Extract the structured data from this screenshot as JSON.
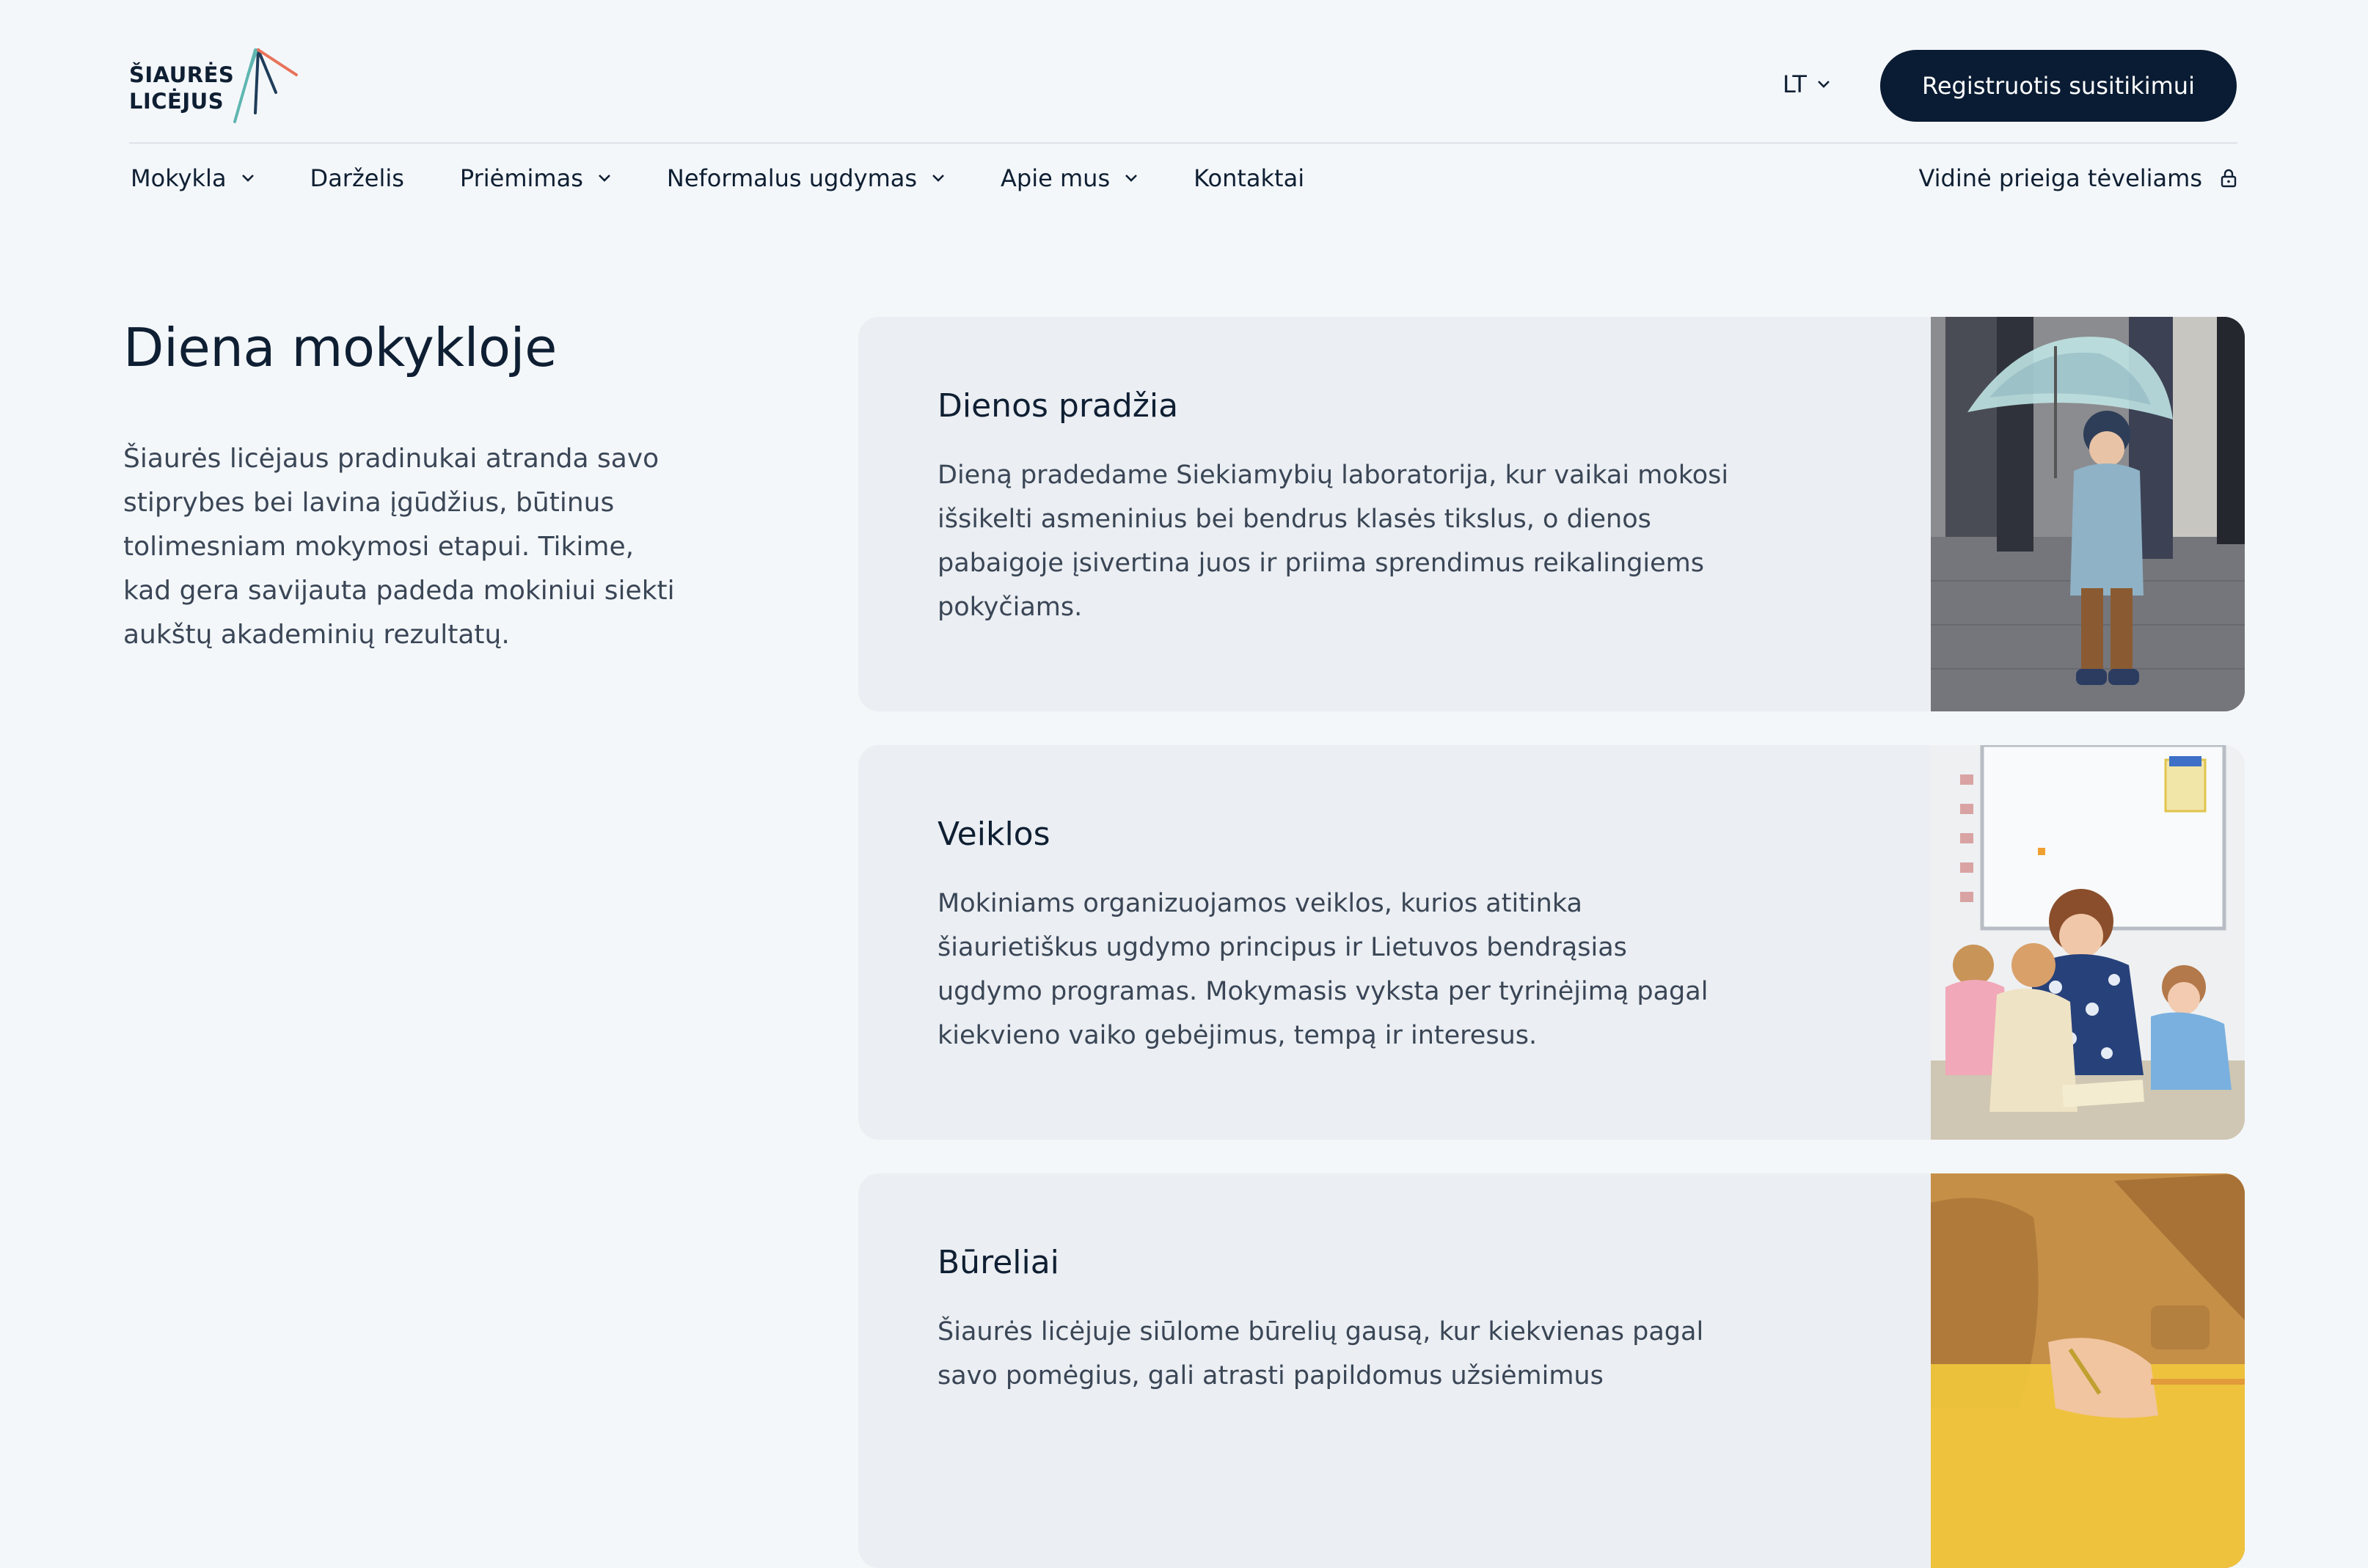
{
  "header": {
    "logo_line1": "ŠIAURĖS",
    "logo_line2": "LICĖJUS",
    "lang": "LT",
    "cta_label": "Registruotis susitikimui"
  },
  "nav": {
    "items": [
      {
        "label": "Mokykla",
        "dropdown": true
      },
      {
        "label": "Darželis",
        "dropdown": false
      },
      {
        "label": "Priėmimas",
        "dropdown": true
      },
      {
        "label": "Neformalus ugdymas",
        "dropdown": true
      },
      {
        "label": "Apie mus",
        "dropdown": true
      },
      {
        "label": "Kontaktai",
        "dropdown": false
      }
    ],
    "parent_access": "Vidinė prieiga tėveliams",
    "parent_access_icon": "lock-icon"
  },
  "intro": {
    "title": "Diena mokykloje",
    "text": "Šiaurės licėjaus pradinukai atranda savo stiprybes bei lavina įgūdžius, būtinus tolimesniam mokymosi etapui. Tikime, kad gera savijauta padeda mokiniui siekti aukštų akademinių rezultatų."
  },
  "cards": [
    {
      "title": "Dienos pradžia",
      "text": "Dieną pradedame Siekiamybių laboratorija, kur vaikai mokosi išsikelti asmeninius bei bendrus klasės tikslus, o dienos pabaigoje įsivertina juos ir priima sprendimus reikalingiems pokyčiams.",
      "image": "child-with-umbrella-photo"
    },
    {
      "title": "Veiklos",
      "text": "Mokiniams organizuojamos veiklos, kurios atitinka šiaurietiškus ugdymo principus ir Lietuvos bendrąsias ugdymo programas. Mokymasis vyksta per tyrinėjimą pagal kiekvieno vaiko gebėjimus, tempą ir interesus.",
      "image": "teacher-with-children-photo"
    },
    {
      "title": "Būreliai",
      "text": "Šiaurės licėjuje siūlome būrelių gausą, kur kiekvienas pagal savo pomėgius, gali atrasti papildomus užsiėmimus",
      "image": "child-drawing-photo"
    }
  ],
  "colors": {
    "background": "#f4f7fa",
    "card": "#ebeef2",
    "navy": "#0a1c33",
    "logo_teal": "#5fb6b0",
    "logo_coral": "#e8735a"
  }
}
